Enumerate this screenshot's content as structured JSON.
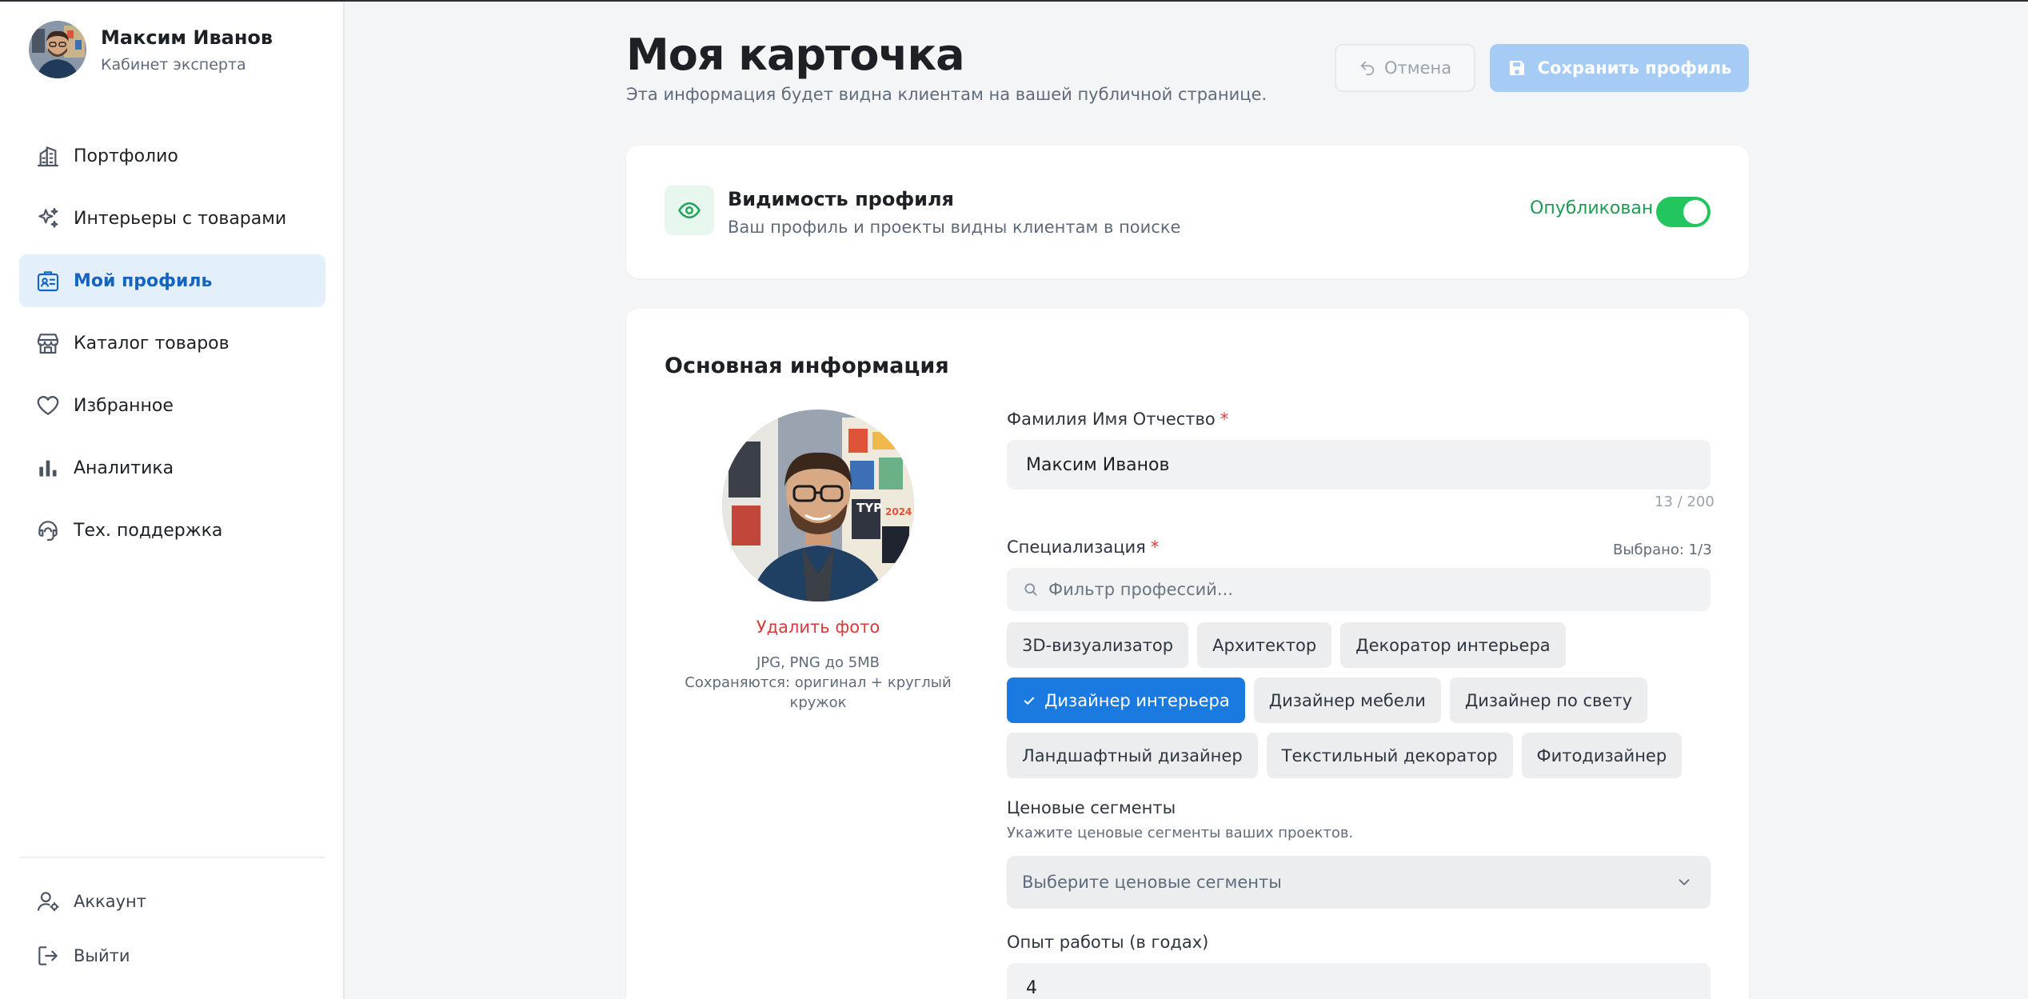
{
  "user": {
    "name": "Максим Иванов",
    "role": "Кабинет эксперта"
  },
  "sidebar": {
    "items": [
      {
        "label": "Портфолио",
        "icon": "building-icon",
        "active": false
      },
      {
        "label": "Интерьеры с товарами",
        "icon": "sparkles-icon",
        "active": false
      },
      {
        "label": "Мой профиль",
        "icon": "id-card-icon",
        "active": true
      },
      {
        "label": "Каталог товаров",
        "icon": "store-icon",
        "active": false
      },
      {
        "label": "Избранное",
        "icon": "heart-icon",
        "active": false
      },
      {
        "label": "Аналитика",
        "icon": "bar-chart-icon",
        "active": false
      },
      {
        "label": "Тех. поддержка",
        "icon": "headset-icon",
        "active": false
      }
    ],
    "bottom": [
      {
        "label": "Аккаунт",
        "icon": "user-settings-icon"
      },
      {
        "label": "Выйти",
        "icon": "logout-icon"
      }
    ]
  },
  "header": {
    "title": "Моя карточка",
    "subtitle": "Эта информация будет видна клиентам на вашей публичной странице.",
    "cancel_label": "Отмена",
    "save_label": "Сохранить профиль"
  },
  "visibility": {
    "title": "Видимость профиля",
    "description": "Ваш профиль и проекты видны клиентам в поиске",
    "status": "Опубликован",
    "enabled": true
  },
  "main_info": {
    "section_title": "Основная информация",
    "delete_photo": "Удалить фото",
    "photo_hint_1": "JPG, PNG до 5MB",
    "photo_hint_2": "Сохраняются: оригинал + круглый кружок",
    "full_name_label": "Фамилия Имя Отчество",
    "full_name_value": "Максим Иванов",
    "full_name_counter": "13 / 200",
    "specialization_label": "Специализация",
    "specialization_selected": "Выбрано: 1/3",
    "specialization_filter_placeholder": "Фильтр профессий...",
    "specializations": [
      [
        "3D-визуализатор",
        "Архитектор",
        "Декоратор интерьера"
      ],
      [
        "Дизайнер интерьера",
        "Дизайнер мебели",
        "Дизайнер по свету"
      ],
      [
        "Ландшафтный дизайнер",
        "Текстильный декоратор",
        "Фитодизайнер"
      ]
    ],
    "selected_specialization": "Дизайнер интерьера",
    "price_label": "Ценовые сегменты",
    "price_hint": "Укажите ценовые сегменты ваших проектов.",
    "price_placeholder": "Выберите ценовые сегменты",
    "experience_label": "Опыт работы (в годах)",
    "experience_value": "4"
  },
  "colors": {
    "accent": "#1a7ae0",
    "active_nav_bg": "#e3f0fc",
    "success": "#22c55e",
    "danger": "#d93a3a"
  }
}
